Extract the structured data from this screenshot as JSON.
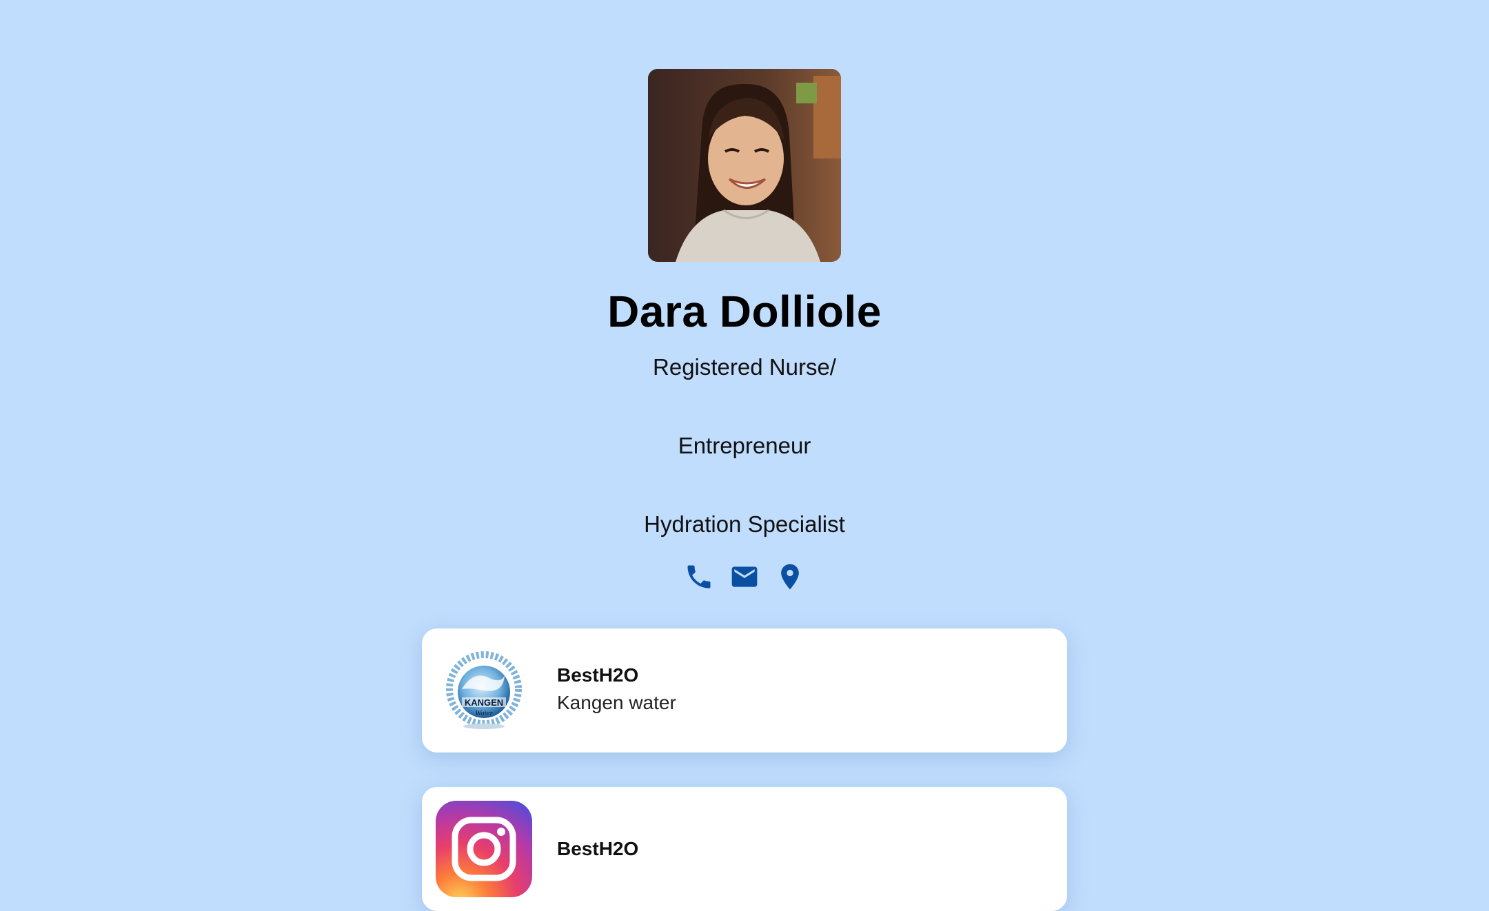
{
  "profile": {
    "name": "Dara Dolliole",
    "titles": [
      "Registered Nurse/",
      "Entrepreneur",
      "Hydration Specialist"
    ]
  },
  "contact": {
    "icons": [
      "phone-icon",
      "email-icon",
      "location-icon"
    ],
    "icon_color": "#0b4fa3"
  },
  "links": [
    {
      "title": "BestH2O",
      "subtitle": "Kangen water",
      "icon": "kangen-water-logo"
    },
    {
      "title": "BestH2O",
      "subtitle": "",
      "icon": "instagram-icon"
    }
  ],
  "colors": {
    "background": "#c0ddfd",
    "card": "#ffffff",
    "accent": "#0b4fa3"
  }
}
